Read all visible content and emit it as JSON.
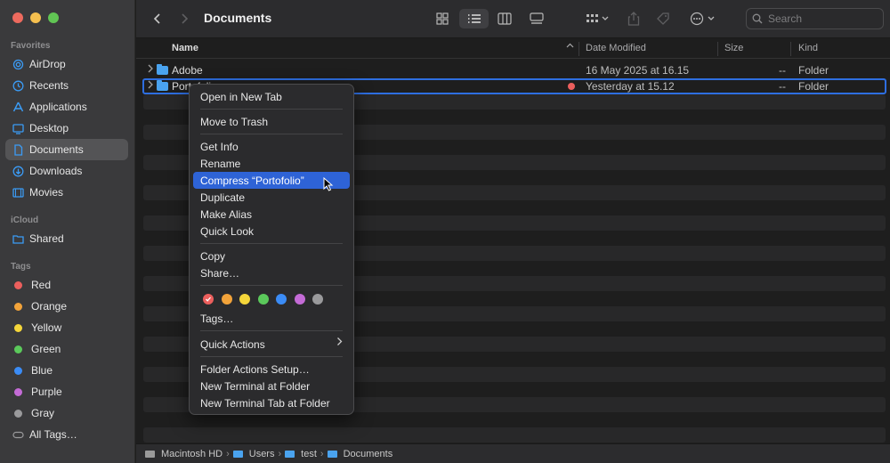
{
  "window": {
    "title": "Documents"
  },
  "sidebar": {
    "favorites_title": "Favorites",
    "favorites": [
      {
        "label": "AirDrop",
        "icon": "airdrop-icon"
      },
      {
        "label": "Recents",
        "icon": "clock-icon"
      },
      {
        "label": "Applications",
        "icon": "applications-icon"
      },
      {
        "label": "Desktop",
        "icon": "desktop-icon"
      },
      {
        "label": "Documents",
        "icon": "document-icon",
        "active": true
      },
      {
        "label": "Downloads",
        "icon": "download-icon"
      },
      {
        "label": "Movies",
        "icon": "film-icon"
      }
    ],
    "icloud_title": "iCloud",
    "icloud": [
      {
        "label": "Shared",
        "icon": "shared-folder-icon"
      }
    ],
    "tags_title": "Tags",
    "tags": [
      {
        "label": "Red",
        "color": "#ec5f5d"
      },
      {
        "label": "Orange",
        "color": "#f2a33a"
      },
      {
        "label": "Yellow",
        "color": "#f5d63a"
      },
      {
        "label": "Green",
        "color": "#5bc95b"
      },
      {
        "label": "Blue",
        "color": "#3b8cf6"
      },
      {
        "label": "Purple",
        "color": "#c46bd6"
      },
      {
        "label": "Gray",
        "color": "#9a9a9c"
      },
      {
        "label": "All Tags…",
        "color": ""
      }
    ]
  },
  "toolbar": {
    "search_placeholder": "Search"
  },
  "columns": {
    "name": "Name",
    "date": "Date Modified",
    "size": "Size",
    "kind": "Kind"
  },
  "files": [
    {
      "name": "Adobe",
      "date": "16 May 2025 at 16.15",
      "size": "--",
      "kind": "Folder"
    },
    {
      "name": "Portofolio",
      "date": "Yesterday at 15.12",
      "size": "--",
      "kind": "Folder"
    }
  ],
  "context_menu": {
    "open_new_tab": "Open in New Tab",
    "move_to_trash": "Move to Trash",
    "get_info": "Get Info",
    "rename": "Rename",
    "compress": "Compress “Portofolio”",
    "duplicate": "Duplicate",
    "make_alias": "Make Alias",
    "quick_look": "Quick Look",
    "copy": "Copy",
    "share": "Share…",
    "tag_colors": [
      "#ec5f5d",
      "#f2a33a",
      "#f5d63a",
      "#5bc95b",
      "#3b8cf6",
      "#c46bd6",
      "#9a9a9c"
    ],
    "tags": "Tags…",
    "quick_actions": "Quick Actions",
    "folder_actions_setup": "Folder Actions Setup…",
    "new_terminal": "New Terminal at Folder",
    "new_terminal_tab": "New Terminal Tab at Folder"
  },
  "pathbar": [
    "Macintosh HD",
    "Users",
    "test",
    "Documents"
  ]
}
